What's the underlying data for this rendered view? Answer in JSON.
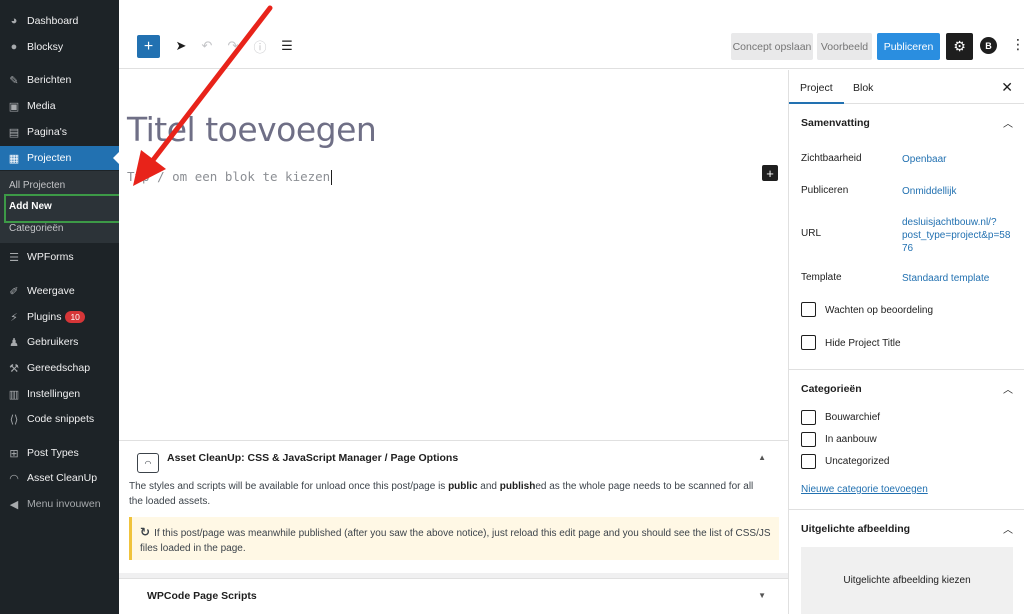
{
  "admin_menu": {
    "items": [
      {
        "label": "Dashboard",
        "icon": "dashboard-icon"
      },
      {
        "label": "Blocksy",
        "icon": "blocksy-icon"
      },
      {
        "label": "Berichten",
        "icon": "pin-icon"
      },
      {
        "label": "Media",
        "icon": "media-icon"
      },
      {
        "label": "Pagina's",
        "icon": "pages-icon"
      },
      {
        "label": "Projecten",
        "icon": "portfolio-icon"
      },
      {
        "label": "WPForms",
        "icon": "wpforms-icon"
      },
      {
        "label": "Weergave",
        "icon": "brush-icon"
      },
      {
        "label": "Plugins",
        "icon": "plugin-icon",
        "badge": "10"
      },
      {
        "label": "Gebruikers",
        "icon": "users-icon"
      },
      {
        "label": "Gereedschap",
        "icon": "wrench-icon"
      },
      {
        "label": "Instellingen",
        "icon": "settings-icon"
      },
      {
        "label": "Code snippets",
        "icon": "code-icon"
      },
      {
        "label": "Post Types",
        "icon": "grid-icon"
      },
      {
        "label": "Asset CleanUp",
        "icon": "gauge-icon"
      },
      {
        "label": "Menu invouwen",
        "icon": "collapse-icon"
      }
    ],
    "submenu": [
      "All Projecten",
      "Add New",
      "Categorieën"
    ]
  },
  "toolbar": {
    "draft_label": "Concept opslaan",
    "preview_label": "Voorbeeld",
    "publish_label": "Publiceren",
    "blocksy_letter": "B"
  },
  "editor": {
    "title_placeholder": "Titel toevoegen",
    "block_placeholder": "Typ / om een blok te kiezen"
  },
  "metabox_asset": {
    "title": "Asset CleanUp: CSS & JavaScript Manager / Page Options",
    "desc_1": "The styles and scripts will be available for unload once this post/page is ",
    "desc_public": "public",
    "desc_2": " and ",
    "desc_published": "publish",
    "desc_3": "ed as the whole page needs to be scanned for all the loaded assets.",
    "notice": "If this post/page was meanwhile published (after you saw the above notice), just reload this edit page and you should see the list of CSS/JS files loaded in the page."
  },
  "metabox_wpcode": {
    "title": "WPCode Page Scripts"
  },
  "settings_panel": {
    "tab_project": "Project",
    "tab_block": "Blok",
    "summary_title": "Samenvatting",
    "visibility_label": "Zichtbaarheid",
    "visibility_value": "Openbaar",
    "publish_label": "Publiceren",
    "publish_value": "Onmiddellijk",
    "url_label": "URL",
    "url_value_1": "desluisjachtbouw.nl/?",
    "url_value_2": "post_type=project&p=58",
    "url_value_3": "76",
    "template_label": "Template",
    "template_value": "Standaard template",
    "pending_review": "Wachten op beoordeling",
    "hide_title": "Hide Project Title",
    "categories_title": "Categorieën",
    "categories": [
      "Bouwarchief",
      "In aanbouw",
      "Uncategorized"
    ],
    "new_category": "Nieuwe categorie toevoegen",
    "featured_title": "Uitgelichte afbeelding",
    "featured_button": "Uitgelichte afbeelding kiezen"
  },
  "colors": {
    "admin_bg": "#1d2327",
    "accent": "#2271b1",
    "publish": "#2a8ee0",
    "highlight": "#3d9a47",
    "arrow": "#e8231a"
  }
}
